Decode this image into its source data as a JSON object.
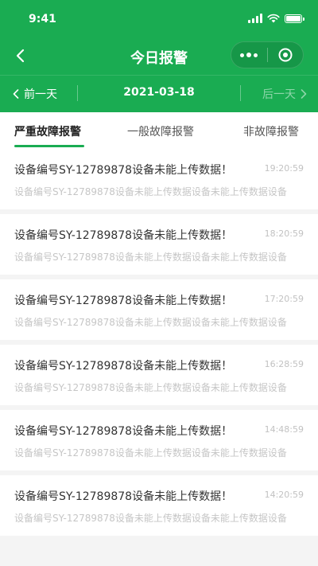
{
  "status_bar": {
    "time": "9:41"
  },
  "nav": {
    "title": "今日报警"
  },
  "date_bar": {
    "prev_label": "前一天",
    "current_date": "2021-03-18",
    "next_label": "后一天"
  },
  "tabs": [
    {
      "label": "严重故障报警",
      "active": true
    },
    {
      "label": "一般故障报警",
      "active": false
    },
    {
      "label": "非故障报警",
      "active": false
    }
  ],
  "alarms": [
    {
      "title": "设备编号SY-12789878设备未能上传数据！",
      "time": "19:20:59",
      "description": "设备编号SY-12789878设备未能上传数据设备未能上传数据设备"
    },
    {
      "title": "设备编号SY-12789878设备未能上传数据！",
      "time": "18:20:59",
      "description": "设备编号SY-12789878设备未能上传数据设备未能上传数据设备"
    },
    {
      "title": "设备编号SY-12789878设备未能上传数据！",
      "time": "17:20:59",
      "description": "设备编号SY-12789878设备未能上传数据设备未能上传数据设备"
    },
    {
      "title": "设备编号SY-12789878设备未能上传数据！",
      "time": "16:28:59",
      "description": "设备编号SY-12789878设备未能上传数据设备未能上传数据设备"
    },
    {
      "title": "设备编号SY-12789878设备未能上传数据！",
      "time": "14:48:59",
      "description": "设备编号SY-12789878设备未能上传数据设备未能上传数据设备"
    },
    {
      "title": "设备编号SY-12789878设备未能上传数据！",
      "time": "14:20:59",
      "description": "设备编号SY-12789878设备未能上传数据设备未能上传数据设备"
    }
  ],
  "colors": {
    "brand_green": "#1aac52",
    "background": "#f4f4f4",
    "card": "#ffffff"
  },
  "icons": [
    "back-icon",
    "more-icon",
    "target-icon",
    "chevron-left-icon",
    "chevron-right-icon",
    "signal-icon",
    "wifi-icon",
    "battery-icon"
  ]
}
